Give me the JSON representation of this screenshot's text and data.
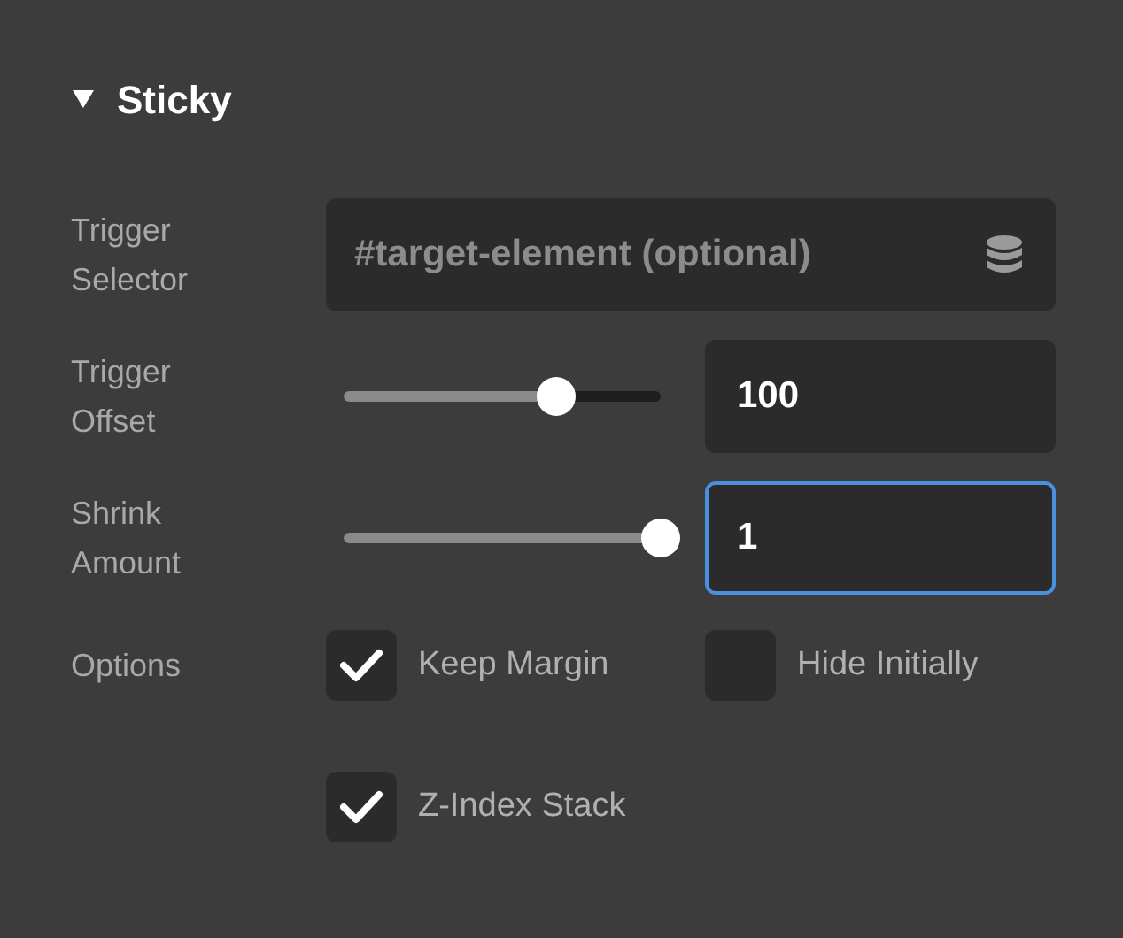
{
  "section": {
    "title": "Sticky",
    "expanded": true
  },
  "trigger_selector": {
    "label": "Trigger Selector",
    "placeholder": "#target-element (optional)"
  },
  "sliders": [
    {
      "label": "Trigger Offset",
      "level": 0.67,
      "value": "100",
      "focused": false
    },
    {
      "label": "Shrink Amount",
      "level": 1,
      "value": "1",
      "focused": true
    }
  ],
  "options": {
    "label": "Options",
    "items": [
      {
        "label": "Keep Margin",
        "checked": true
      },
      {
        "label": "Hide Initially",
        "checked": false
      },
      {
        "label": "Z-Index Stack",
        "checked": true
      }
    ]
  }
}
